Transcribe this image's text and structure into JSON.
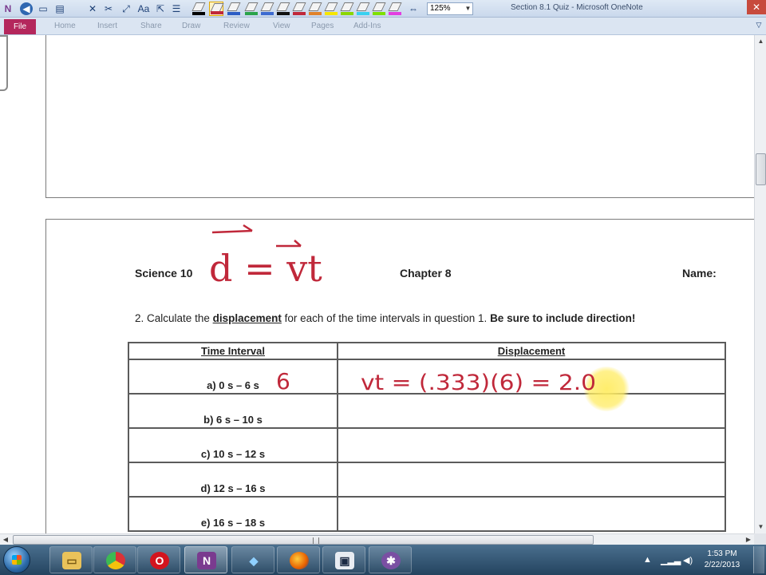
{
  "window": {
    "title": "Section 8.1 Quiz - Microsoft OneNote",
    "close_glyph": "✕",
    "zoom_value": "125%"
  },
  "ribbon": {
    "file_label": "File",
    "tabs": [
      "Home",
      "Insert",
      "Share",
      "Draw",
      "Review",
      "View",
      "Pages",
      "Add-Ins"
    ]
  },
  "worksheet": {
    "course": "Science 10",
    "chapter": "Chapter 8",
    "name_label": "Name:",
    "question_number": "2.",
    "q_text_1": "Calculate the",
    "q_keyword": "displacement",
    "q_text_2": "for each of the time intervals in question 1.",
    "q_emphasis": "Be sure to include direction!",
    "table": {
      "headers": [
        "Time Interval",
        "Displacement"
      ],
      "rows": [
        "a) 0 s – 6 s",
        "b) 6 s – 10 s",
        "c) 10 s – 12 s",
        "d) 12 s – 16 s",
        "e) 16 s – 18 s"
      ]
    }
  },
  "ink": {
    "color": "#c0283a",
    "formula_top": "d = vt",
    "row_a_time": "6",
    "row_a_work": "vt = (.333)(6) = 2.0"
  },
  "taskbar": {
    "clock_time": "1:53 PM",
    "clock_date": "2/22/2013"
  },
  "colors": {
    "file_tab": "#b4275c",
    "onenote_purple": "#7a3b8f",
    "taskbar": "#2e5170"
  }
}
